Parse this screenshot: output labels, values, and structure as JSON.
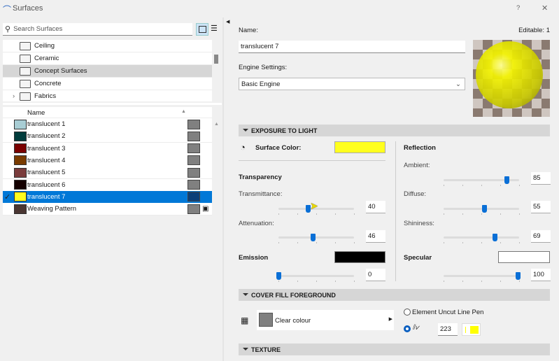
{
  "window": {
    "title": "Surfaces",
    "help": "?",
    "close": "✕"
  },
  "search": {
    "placeholder": "Search Surfaces"
  },
  "folders": [
    {
      "label": "Ceiling"
    },
    {
      "label": "Ceramic"
    },
    {
      "label": "Concept Surfaces",
      "selected": true
    },
    {
      "label": "Concrete"
    },
    {
      "label": "Fabrics",
      "expandable": true
    }
  ],
  "table": {
    "header": "Name",
    "rows": [
      {
        "name": "translucent 1",
        "color": "#a8cdd4"
      },
      {
        "name": "translucent 2",
        "color": "#003c3c"
      },
      {
        "name": "translucent 3",
        "color": "#7a0000"
      },
      {
        "name": "translucent 4",
        "color": "#7a3c00"
      },
      {
        "name": "translucent 5",
        "color": "#7a3c3c"
      },
      {
        "name": "translucent 6",
        "color": "#140000"
      },
      {
        "name": "translucent 7",
        "color": "#ffff1e",
        "selected": true
      },
      {
        "name": "Weaving Pattern",
        "color": "#4a3632",
        "texture": true
      }
    ]
  },
  "detail": {
    "name_label": "Name:",
    "name_value": "translucent 7",
    "editable": "Editable: 1",
    "engine_label": "Engine Settings:",
    "engine_value": "Basic Engine"
  },
  "exposure": {
    "header": "EXPOSURE TO LIGHT",
    "surface_color_label": "Surface Color:",
    "surface_color": "#ffff1e",
    "transparency": "Transparency",
    "transmittance_label": "Transmittance:",
    "transmittance": "40",
    "attenuation_label": "Attenuation:",
    "attenuation": "46",
    "emission_label": "Emission",
    "emission_color": "#000000",
    "emission": "0",
    "reflection": "Reflection",
    "ambient_label": "Ambient:",
    "ambient": "85",
    "diffuse_label": "Diffuse:",
    "diffuse": "55",
    "shininess_label": "Shininess:",
    "shininess": "69",
    "specular_label": "Specular",
    "specular_color": "#ffffff",
    "specular": "100"
  },
  "cover_fill": {
    "header": "COVER FILL FOREGROUND",
    "fill_value": "Clear colour",
    "option1": "Element Uncut Line Pen",
    "pen_number": "223",
    "pen_color": "#ffff00"
  },
  "texture": {
    "header": "TEXTURE"
  },
  "accent": "#0078d7"
}
